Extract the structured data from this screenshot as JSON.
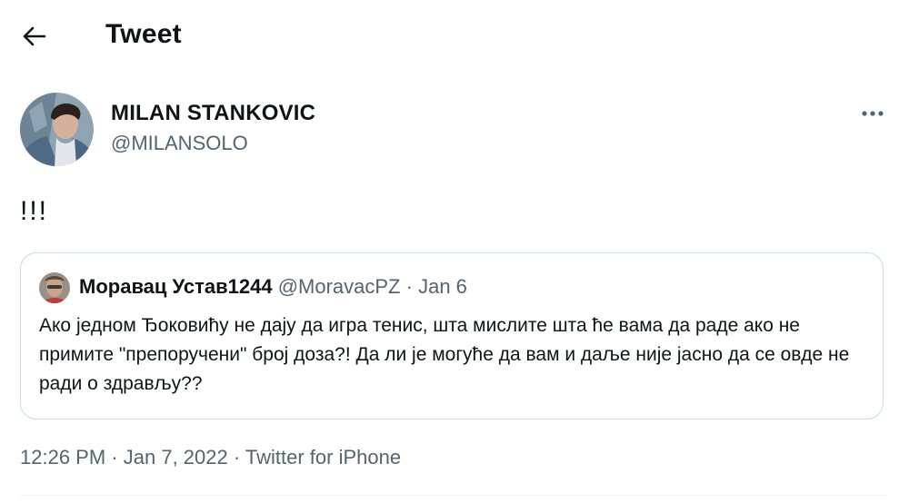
{
  "header": {
    "title": "Tweet",
    "back_icon": "arrow-left-icon"
  },
  "tweet": {
    "author_name": "MILAN STANKOVIC",
    "author_handle": "@MILANSOLO",
    "avatar": "user-avatar-photo",
    "more_icon": "more-horizontal-icon",
    "text": "!!!",
    "time": "12:26 PM",
    "date": "Jan 7, 2022",
    "source": "Twitter for iPhone",
    "separator": "·"
  },
  "quote": {
    "name": "Моравац Устав1244",
    "handle": "@MoravacPZ",
    "separator": "·",
    "date": "Jan 6",
    "text": "Ако једном Ђоковићу не дају да игра тенис, шта мислите шта ће вама да раде ако не примите \"препоручени\" број доза?! Да ли је могуће да вам и даље није јасно да се овде не ради о здрављу??"
  },
  "colors": {
    "text": "#0f1419",
    "secondary": "#536471",
    "border": "#cfd9de",
    "background": "#ffffff"
  }
}
